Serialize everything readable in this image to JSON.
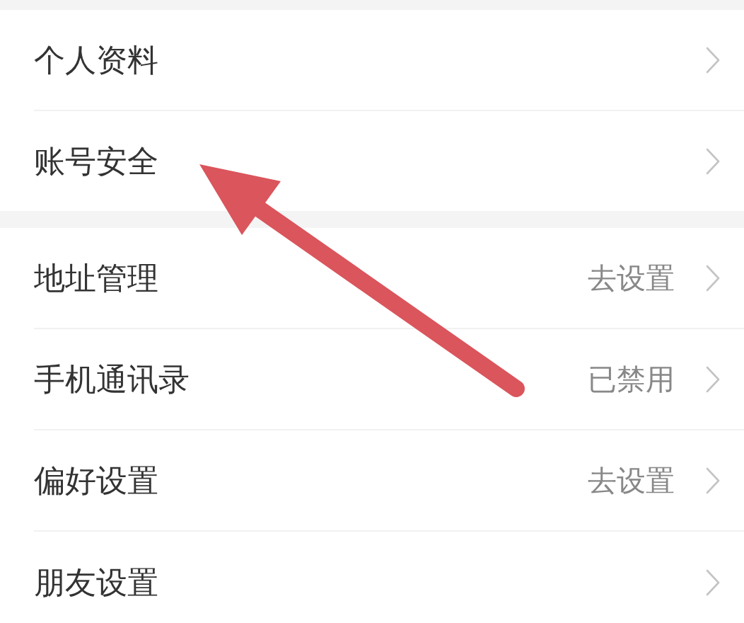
{
  "sections": [
    {
      "items": [
        {
          "label": "个人资料"
        },
        {
          "label": "账号安全"
        }
      ]
    },
    {
      "items": [
        {
          "label": "地址管理",
          "value": "去设置"
        },
        {
          "label": "手机通讯录",
          "value": "已禁用"
        },
        {
          "label": "偏好设置",
          "value": "去设置"
        },
        {
          "label": "朋友设置"
        }
      ]
    }
  ]
}
